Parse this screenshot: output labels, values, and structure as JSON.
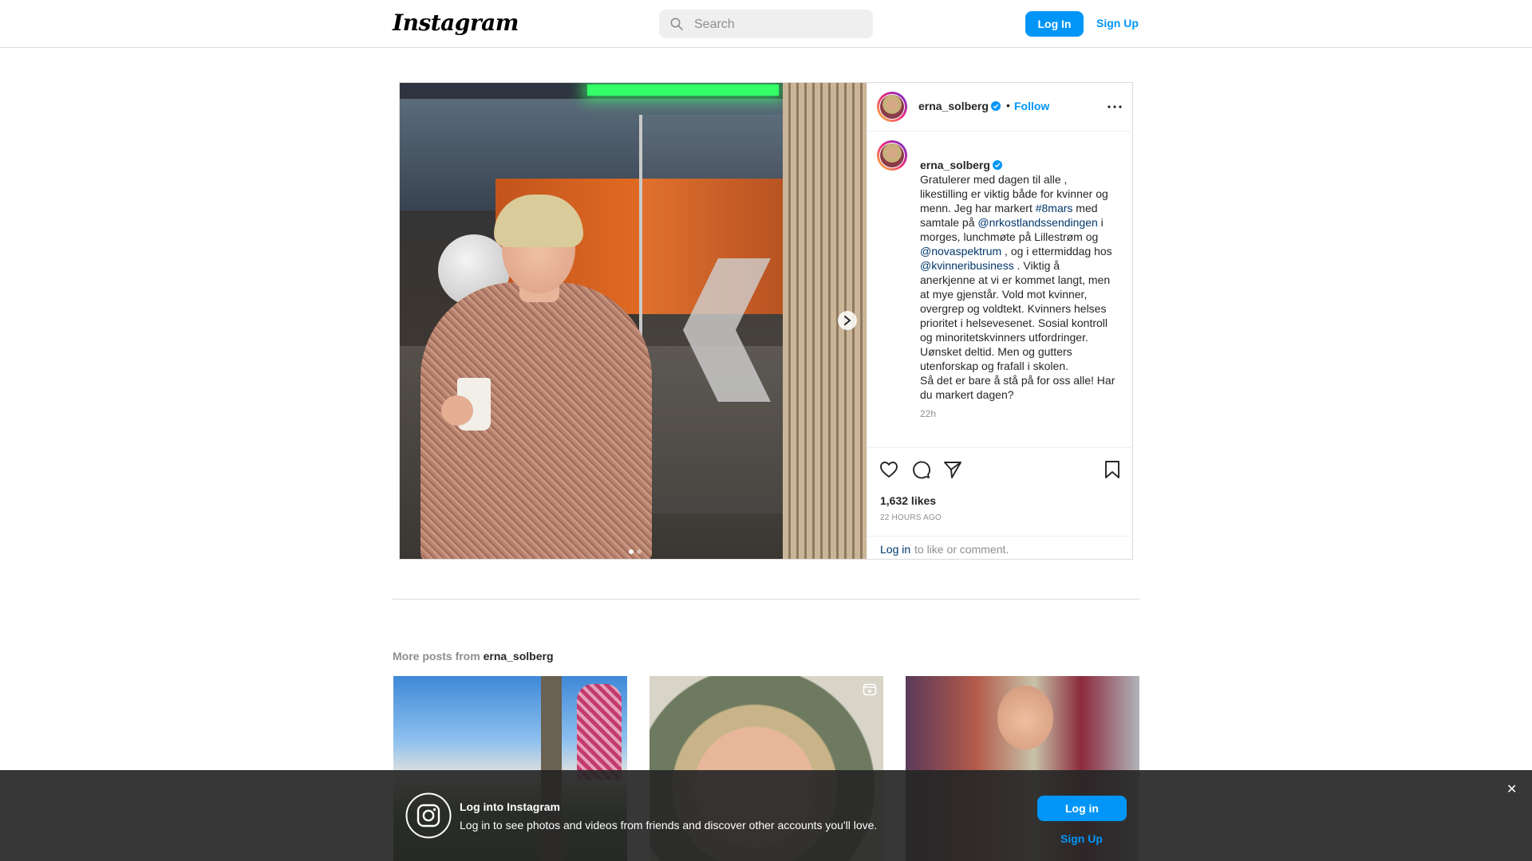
{
  "nav": {
    "logo": "Instagram",
    "search_placeholder": "Search",
    "login_label": "Log In",
    "signup_label": "Sign Up"
  },
  "post": {
    "username": "erna_solberg",
    "separator": "•",
    "follow_label": "Follow",
    "caption_parts": [
      {
        "type": "text",
        "value": "Gratulerer med dagen til alle , likestilling er viktig både for kvinner og menn. Jeg har markert "
      },
      {
        "type": "hashtag",
        "value": "#8mars"
      },
      {
        "type": "text",
        "value": " med samtale på "
      },
      {
        "type": "mention",
        "value": "@nrkostlandssendingen"
      },
      {
        "type": "text",
        "value": " i morges, lunchmøte på Lillestrøm og "
      },
      {
        "type": "mention",
        "value": "@novaspektrum"
      },
      {
        "type": "text",
        "value": " , og i ettermiddag hos "
      },
      {
        "type": "mention",
        "value": "@kvinneribusiness"
      },
      {
        "type": "text",
        "value": " . Viktig å anerkjenne at vi er kommet langt, men at mye gjenstår. Vold mot kvinner, overgrep og voldtekt. Kvinners helses prioritet i helsevesenet. Sosial kontroll og minoritetskvinners utfordringer. Uønsket deltid. Men og gutters utenforskap og frafall i skolen.\nSå det er bare å stå på for oss alle! Har du markert dagen?"
      }
    ],
    "caption_time": "22h",
    "likes": "1,632 likes",
    "posted_ago": "22 HOURS AGO",
    "login_link": "Log in",
    "login_suffix": "to like or comment.",
    "carousel": {
      "slides": 2,
      "active": 1
    }
  },
  "more_posts": {
    "prefix": "More posts from",
    "username": "erna_solberg"
  },
  "banner": {
    "title": "Log into Instagram",
    "subtitle": "Log in to see photos and videos from friends and discover other accounts you'll love.",
    "login_label": "Log in",
    "signup_label": "Sign Up",
    "close_glyph": "✕"
  },
  "colors": {
    "accent": "#0095f6",
    "link": "#00376b",
    "muted": "#8e8e8e",
    "banner_bg": "#262626"
  }
}
